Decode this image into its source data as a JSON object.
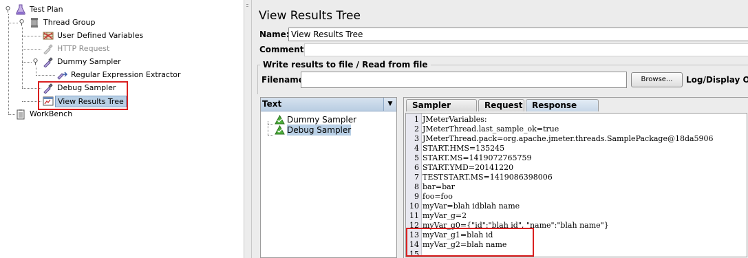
{
  "tree": {
    "items": [
      {
        "label": "Test Plan",
        "icon": "flask-icon"
      },
      {
        "label": "Thread Group",
        "icon": "spool-icon"
      },
      {
        "label": "User Defined Variables",
        "icon": "variables-icon"
      },
      {
        "label": "HTTP Request",
        "icon": "pipette-icon"
      },
      {
        "label": "Dummy Sampler",
        "icon": "pipette-icon"
      },
      {
        "label": "Regular Expression Extractor",
        "icon": "extractor-icon"
      },
      {
        "label": "Debug Sampler",
        "icon": "pipette-icon"
      },
      {
        "label": "View Results Tree",
        "icon": "results-icon"
      },
      {
        "label": "WorkBench",
        "icon": "clipboard-icon"
      }
    ]
  },
  "panel": {
    "title": "View Results Tree",
    "name_label": "Name:",
    "name_value": "View Results Tree",
    "comments_label": "Comments:",
    "write_group_title": "Write results to file / Read from file",
    "filename_label": "Filename",
    "filename_value": "",
    "browse_label": "Browse...",
    "log_display_label": "Log/Display Only"
  },
  "results": {
    "renderer": "Text",
    "items": [
      {
        "label": "Dummy Sampler",
        "status_icon": "success-triangle-icon"
      },
      {
        "label": "Debug Sampler",
        "status_icon": "success-triangle-icon"
      }
    ]
  },
  "tabs": [
    {
      "label": "Sampler result"
    },
    {
      "label": "Request"
    },
    {
      "label": "Response data"
    }
  ],
  "response": {
    "lines": [
      {
        "n": "1",
        "text": "JMeterVariables:"
      },
      {
        "n": "2",
        "text": "JMeterThread.last_sample_ok=true"
      },
      {
        "n": "3",
        "text": "JMeterThread.pack=org.apache.jmeter.threads.SamplePackage@18da5906"
      },
      {
        "n": "4",
        "text": "START.HMS=135245"
      },
      {
        "n": "5",
        "text": "START.MS=1419072765759"
      },
      {
        "n": "6",
        "text": "START.YMD=20141220"
      },
      {
        "n": "7",
        "text": "TESTSTART.MS=1419086398006"
      },
      {
        "n": "8",
        "text": "bar=bar"
      },
      {
        "n": "9",
        "text": "foo=foo"
      },
      {
        "n": "10",
        "text": "myVar=blah idblah name"
      },
      {
        "n": "11",
        "text": "myVar_g=2"
      },
      {
        "n": "12",
        "text": "myVar_g0={\"id\":\"blah id\", \"name\":\"blah name\"}"
      },
      {
        "n": "13",
        "text": "myVar_g1=blah id"
      },
      {
        "n": "14",
        "text": "myVar_g2=blah name"
      },
      {
        "n": "15",
        "text": ""
      }
    ]
  },
  "colors": {
    "selection": "#b8cfe5",
    "highlight_box": "#d92020",
    "line_highlight": "#e3e3ff"
  }
}
